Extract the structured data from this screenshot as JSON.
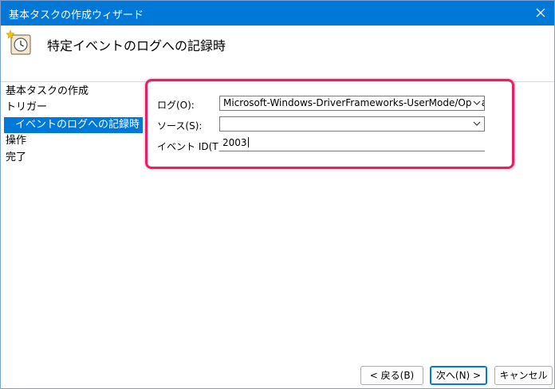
{
  "window": {
    "title": "基本タスクの作成ウィザード"
  },
  "header": {
    "title": "特定イベントのログへの記録時"
  },
  "sidebar": {
    "steps": [
      {
        "label": "基本タスクの作成"
      },
      {
        "label": "トリガー"
      },
      {
        "label": "イベントのログへの記録時",
        "selected": true
      },
      {
        "label": "操作"
      },
      {
        "label": "完了"
      }
    ]
  },
  "form": {
    "log_label": "ログ(O):",
    "log_value": "Microsoft-Windows-DriverFrameworks-UserMode/Operational",
    "source_label": "ソース(S):",
    "source_value": "",
    "event_id_label": "イベント ID(T):",
    "event_id_value": "2003"
  },
  "buttons": {
    "back": "< 戻る(B)",
    "next": "次へ(N) >",
    "cancel": "キャンセル"
  },
  "colors": {
    "accent": "#0078d7",
    "highlight": "#e91e63"
  }
}
